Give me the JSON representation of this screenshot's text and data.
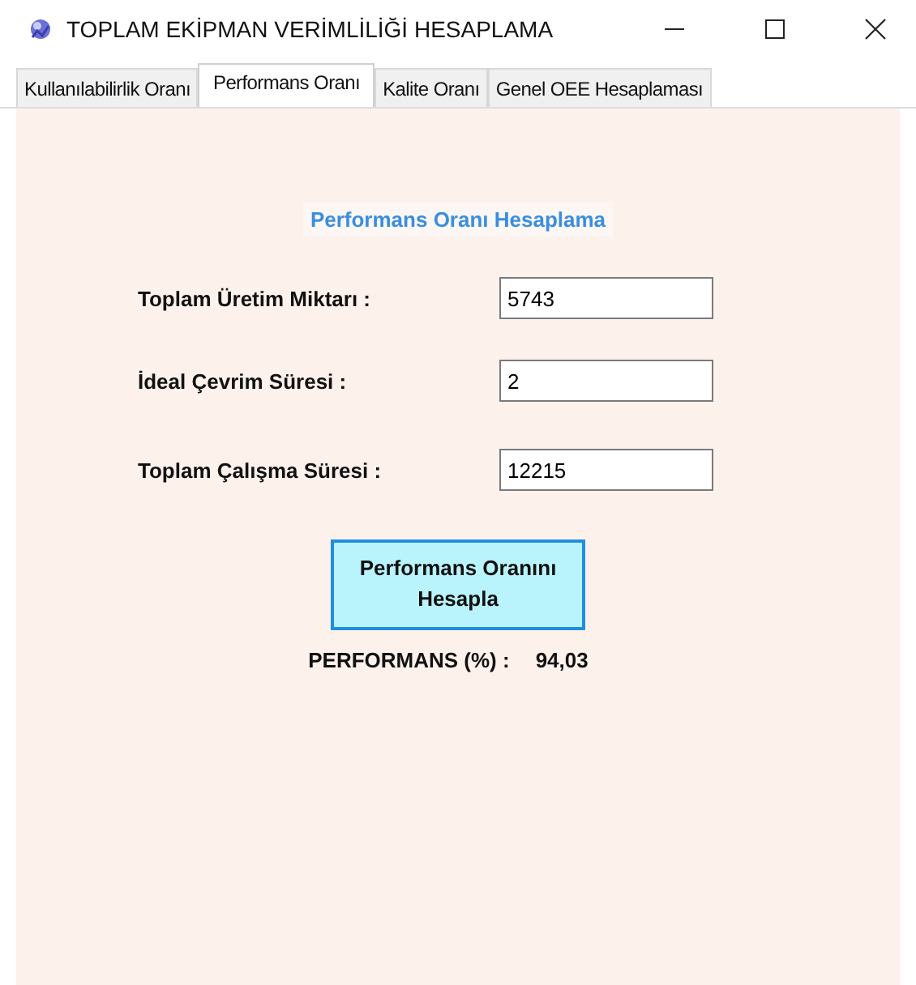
{
  "window": {
    "title": "TOPLAM EKİPMAN VERİMLİLİĞİ HESAPLAMA"
  },
  "tabs": [
    {
      "label": "Kullanılabilirlik Oranı",
      "selected": false
    },
    {
      "label": "Performans Oranı",
      "selected": true
    },
    {
      "label": "Kalite Oranı",
      "selected": false
    },
    {
      "label": "Genel OEE Hesaplaması",
      "selected": false
    }
  ],
  "panel": {
    "heading": "Performans Oranı Hesaplama",
    "fields": [
      {
        "label": "Toplam Üretim Miktarı :",
        "value": "5743"
      },
      {
        "label": "İdeal Çevrim Süresi :",
        "value": "2"
      },
      {
        "label": "Toplam Çalışma Süresi :",
        "value": "12215"
      }
    ],
    "button": "Performans Oranını Hesapla",
    "result_label": "PERFORMANS (%) :",
    "result_value": "94,03"
  }
}
